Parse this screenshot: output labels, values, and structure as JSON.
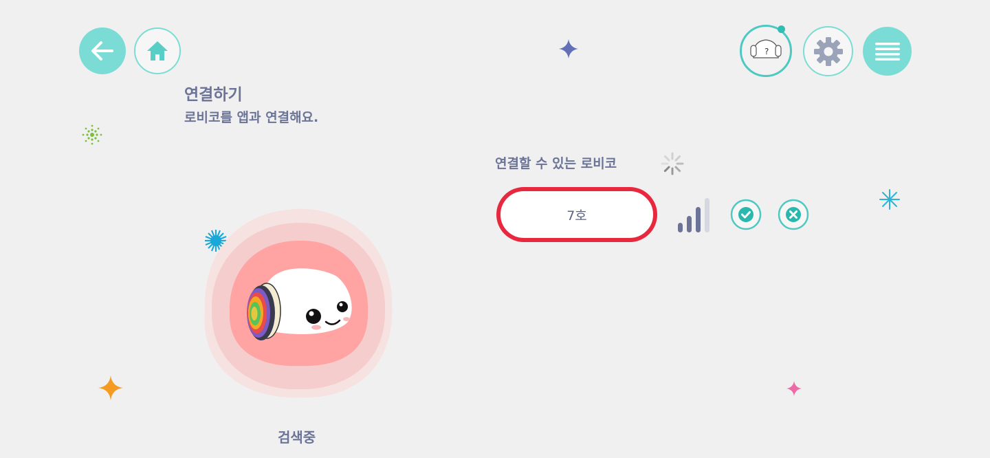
{
  "header": {
    "back_icon": "arrow-left-icon",
    "home_icon": "home-icon",
    "robot_badge_text": "?",
    "settings_icon": "gear-icon",
    "menu_icon": "hamburger-menu-icon"
  },
  "page": {
    "title": "연결하기",
    "subtitle": "로비코를 앱과 연결해요."
  },
  "devices": {
    "label": "연결할 수 있는 로비코",
    "items": [
      {
        "name": "7호",
        "signal_level": 0.75
      }
    ]
  },
  "status": {
    "text": "검색중"
  },
  "colors": {
    "accent": "#7adcd5",
    "accent_dark": "#4fc8c1",
    "highlight": "#e8283e",
    "text": "#6b7496",
    "halo": "#ffa3a3"
  }
}
